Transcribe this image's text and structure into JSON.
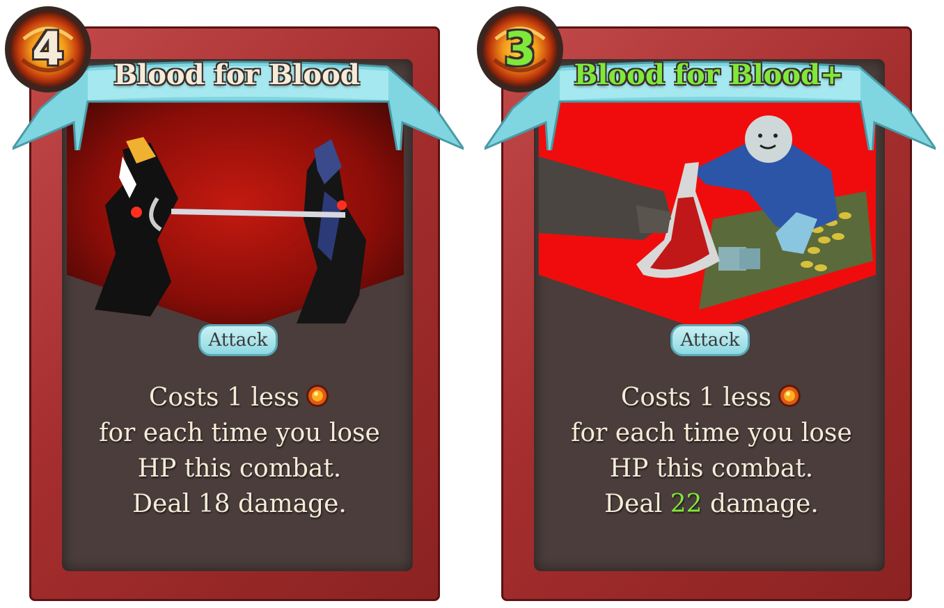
{
  "cards": [
    {
      "id": "base",
      "cost": "4",
      "title": "Blood for Blood",
      "type": "Attack",
      "desc": {
        "line1": "Costs 1 less",
        "line2": "for each time you lose",
        "line3": "HP this combat.",
        "line4_pre": "Deal ",
        "damage": "18",
        "line4_post": " damage."
      },
      "upgraded": false
    },
    {
      "id": "upgraded",
      "cost": "3",
      "title": "Blood for Blood+",
      "type": "Attack",
      "desc": {
        "line1": "Costs 1 less",
        "line2": "for each time you lose",
        "line3": "HP this combat.",
        "line4_pre": "Deal ",
        "damage": "22",
        "line4_post": " damage."
      },
      "upgraded": true
    }
  ],
  "icons": {
    "energy": "energy-orb-icon"
  },
  "colors": {
    "frame_red": "#a52e2e",
    "banner_cyan": "#7fd6e0",
    "text_cream": "#f4ecd8",
    "upgrade_green": "#7fe83a",
    "body_dark": "#4a3d3b"
  }
}
